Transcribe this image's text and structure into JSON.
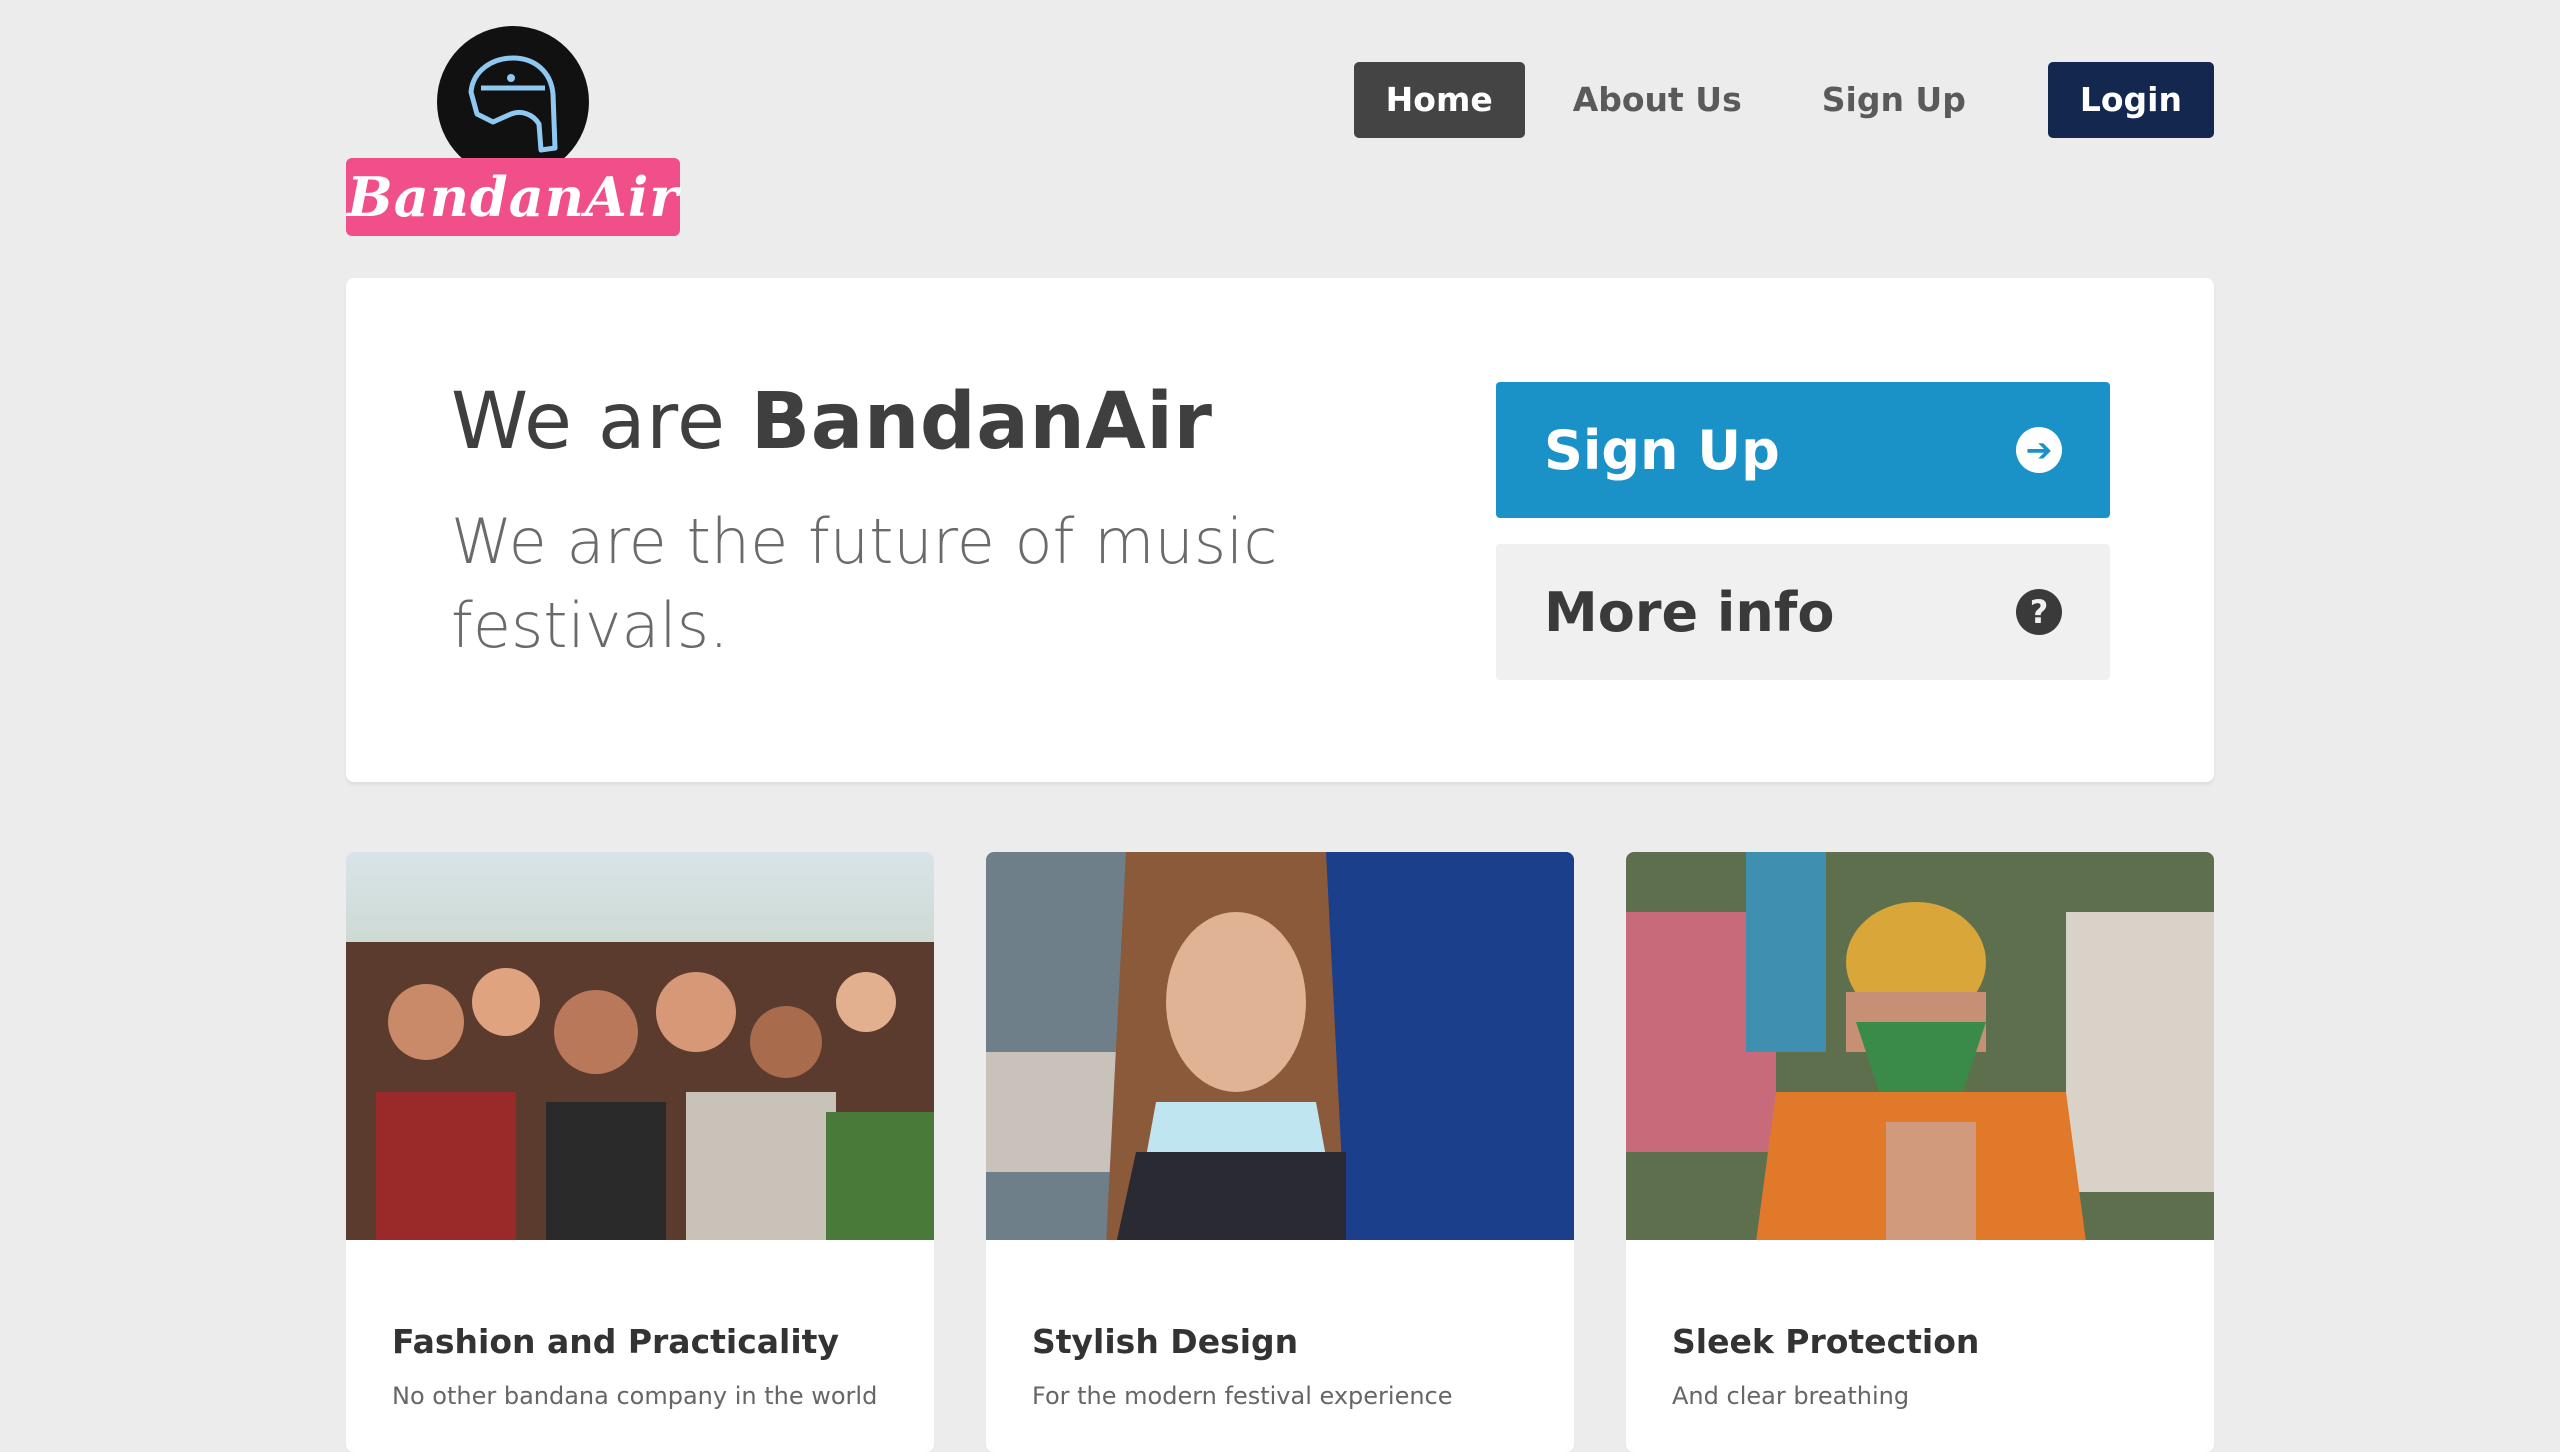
{
  "brand": {
    "name": "BandanAir",
    "colors": {
      "pink": "#f04f8a",
      "dark": "#111111",
      "accent": "#1a92c8",
      "navy": "#14284f"
    },
    "logo_icon": "helmet-icon"
  },
  "nav": {
    "items": [
      {
        "label": "Home",
        "active": true
      },
      {
        "label": "About Us"
      },
      {
        "label": "Sign Up"
      },
      {
        "label": "Login"
      }
    ]
  },
  "hero": {
    "title_prefix": "We are ",
    "title_brand": "BandanAir",
    "subtitle": "We are the future of music festivals.",
    "signup_label": "Sign Up",
    "signup_icon": "arrow-circle-right-icon",
    "more_label": "More info",
    "more_icon": "question-circle-icon"
  },
  "cards": [
    {
      "title": "Fashion and Practicality",
      "text": "No other bandana company in the world"
    },
    {
      "title": "Stylish Design",
      "text": "For the modern festival experience"
    },
    {
      "title": "Sleek Protection",
      "text": "And clear breathing"
    }
  ]
}
